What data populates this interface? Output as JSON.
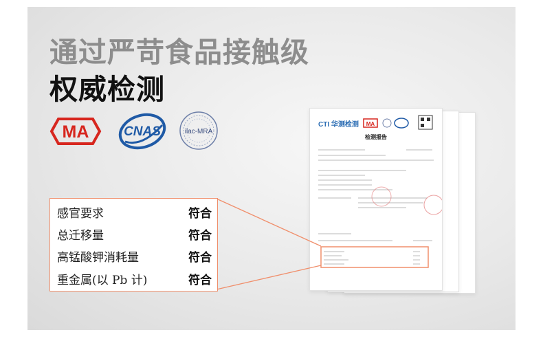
{
  "header": {
    "title_line1": "通过严苛食品接触级",
    "title_line2": "权威检测"
  },
  "logos": {
    "ma": "MA",
    "cnas": "CNAS",
    "ilac": "ilac-MRA"
  },
  "report": {
    "brand": "CTI 华测检测",
    "title": "检测报告"
  },
  "results": [
    {
      "item": "感官要求",
      "result": "符合"
    },
    {
      "item": "总迁移量",
      "result": "符合"
    },
    {
      "item": "高锰酸钾消耗量",
      "result": "符合"
    },
    {
      "item": "重金属(以 Pb 计)",
      "result": "符合"
    }
  ],
  "colors": {
    "accent": "#f08f6c",
    "title_grey": "#8d8d8d",
    "title_dark": "#111111",
    "ma_red": "#d7261e",
    "cnas_blue": "#1f5aa6"
  }
}
